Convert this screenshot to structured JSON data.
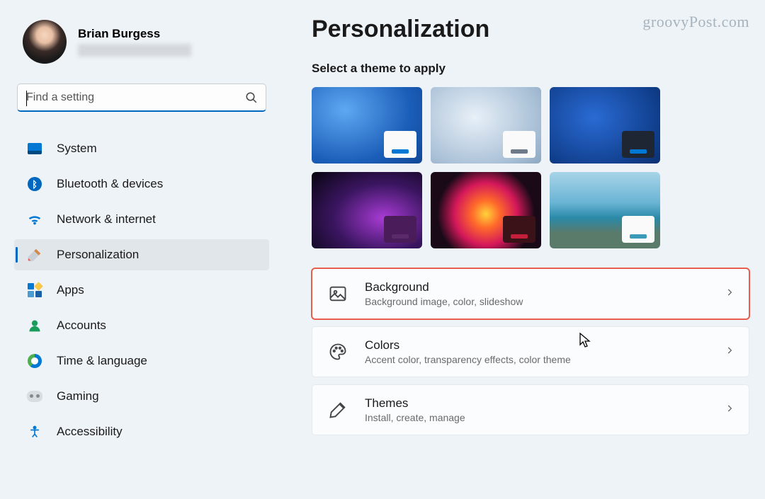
{
  "watermark": "groovyPost.com",
  "user": {
    "name": "Brian Burgess"
  },
  "search": {
    "placeholder": "Find a setting"
  },
  "nav": {
    "items": [
      {
        "label": "System"
      },
      {
        "label": "Bluetooth & devices"
      },
      {
        "label": "Network & internet"
      },
      {
        "label": "Personalization"
      },
      {
        "label": "Apps"
      },
      {
        "label": "Accounts"
      },
      {
        "label": "Time & language"
      },
      {
        "label": "Gaming"
      },
      {
        "label": "Accessibility"
      }
    ],
    "active_index": 3
  },
  "page": {
    "title": "Personalization",
    "theme_label": "Select a theme to apply"
  },
  "options": [
    {
      "title": "Background",
      "subtitle": "Background image, color, slideshow",
      "highlight": true
    },
    {
      "title": "Colors",
      "subtitle": "Accent color, transparency effects, color theme",
      "highlight": false
    },
    {
      "title": "Themes",
      "subtitle": "Install, create, manage",
      "highlight": false
    }
  ]
}
